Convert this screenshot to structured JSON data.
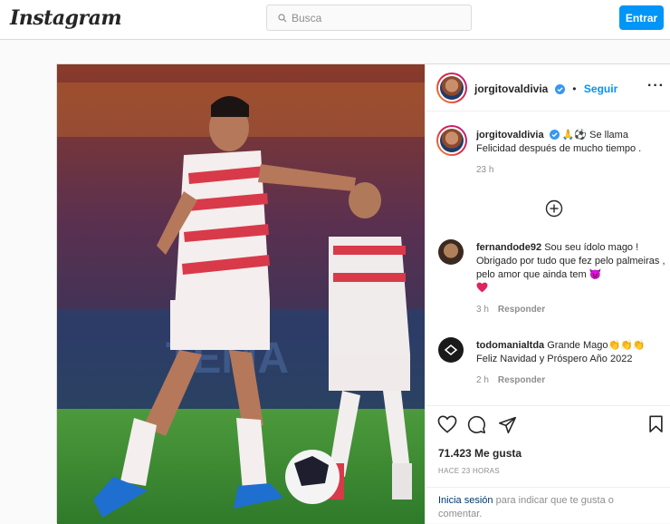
{
  "header": {
    "logo": "Instagram",
    "search_placeholder": "Busca",
    "login_button": "Entrar"
  },
  "post": {
    "username": "jorgitovaldivia",
    "follow_label": "Seguir",
    "dot": "•",
    "more": "···",
    "caption": {
      "username": "jorgitovaldivia",
      "text_line1": "🙏⚽ Se llama",
      "text_line2": "Felicidad después de mucho tiempo .",
      "time": "23 h"
    },
    "comments": [
      {
        "username": "fernandode92",
        "text": "Sou seu ídolo mago ! Obrigado por tudo que fez pelo palmeiras , pelo amor que ainda tem 😈",
        "time": "3 h",
        "reply": "Responder"
      },
      {
        "username": "todomanialtda",
        "text": "Grande Mago👏👏👏 Feliz Navidad y Próspero Año 2022",
        "time": "2 h",
        "reply": "Responder"
      }
    ],
    "likes": "71.423 Me gusta",
    "ago": "HACE 23 HORAS",
    "login_link": "Inicia sesión",
    "login_rest": "para indicar que te gusta o comentar."
  },
  "colors": {
    "accent": "#0095f6",
    "border": "#dbdbdb",
    "heart": "#ed4956"
  }
}
